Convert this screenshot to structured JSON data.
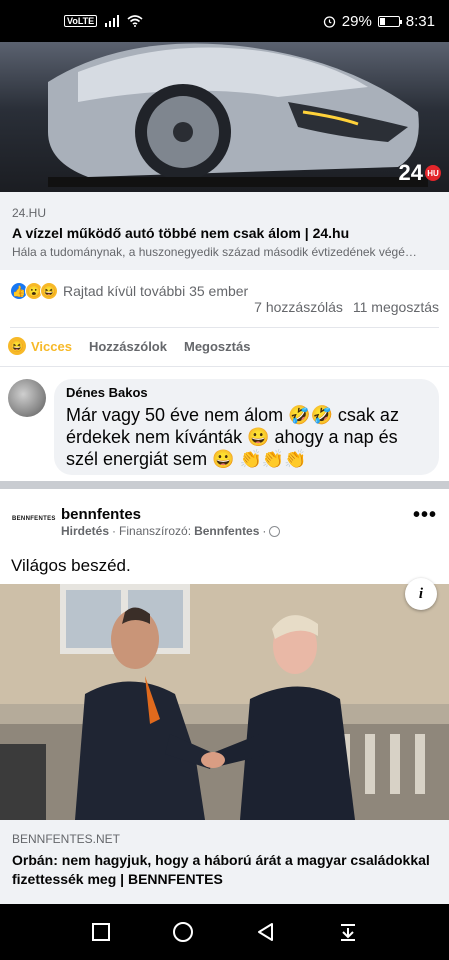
{
  "status_bar": {
    "volte": "VoLTE",
    "battery_percent": "29%",
    "battery_level": 0.29,
    "time": "8:31"
  },
  "post1": {
    "image_logo": "24",
    "image_logo_badge": "HU",
    "link": {
      "domain": "24.HU",
      "title": "A vízzel működő autó többé nem csak álom | 24.hu",
      "description": "Hála a tudománynak, a huszonegyedik század második évtizedének végé…"
    },
    "reactions_text": "Rajtad kívül további 35 ember",
    "comments_count": "7 hozzászólás",
    "shares_count": "11 megosztás",
    "actions": {
      "react": "Vicces",
      "comment": "Hozzászólok",
      "share": "Megosztás"
    }
  },
  "comment": {
    "author": "Dénes Bakos",
    "text": "Már vagy 50 éve nem álom 🤣🤣 csak az érdekek nem kívánták 😀 ahogy a nap és szél energiát sem 😀 👏👏👏"
  },
  "ad": {
    "logo_text": "BENNFENTES",
    "page_name": "bennfentes",
    "sponsored_label": "Hirdetés",
    "funded_by_label": "Finanszírozó:",
    "funder": "Bennfentes",
    "more": "•••",
    "text": "Világos beszéd.",
    "info": "i",
    "link": {
      "domain": "BENNFENTES.NET",
      "title": "Orbán: nem hagyjuk, hogy a háború árát a magyar családokkal fizettessék meg | BENNFENTES"
    }
  },
  "colors": {
    "accent_blue": "#1877f2",
    "haha_yellow": "#f7b928",
    "secondary_text": "#65676b",
    "card_bg": "#f0f2f5"
  }
}
